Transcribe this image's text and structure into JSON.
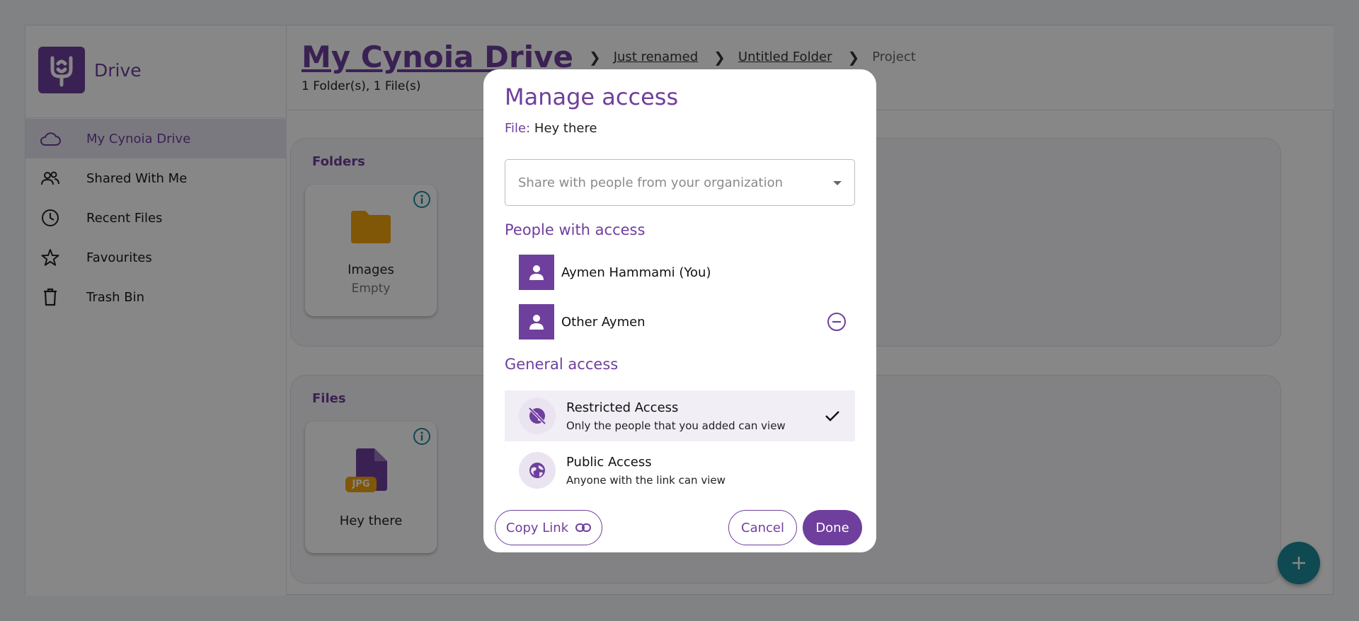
{
  "app": {
    "name": "Drive"
  },
  "sidebar": {
    "items": [
      {
        "label": "My Cynoia Drive",
        "icon": "cloud-icon",
        "active": true
      },
      {
        "label": "Shared With Me",
        "icon": "people-icon"
      },
      {
        "label": "Recent Files",
        "icon": "clock-icon"
      },
      {
        "label": "Favourites",
        "icon": "star-icon"
      },
      {
        "label": "Trash Bin",
        "icon": "trash-icon"
      }
    ]
  },
  "header": {
    "root": "My Cynoia Drive",
    "breadcrumbs": [
      "Just renamed",
      "Untitled Folder",
      "Project"
    ],
    "counts": "1 Folder(s), 1 File(s)"
  },
  "folders": {
    "title": "Folders",
    "items": [
      {
        "name": "Images",
        "status": "Empty"
      }
    ]
  },
  "files": {
    "title": "Files",
    "items": [
      {
        "name": "Hey there",
        "badge": "JPG"
      }
    ]
  },
  "dialog": {
    "title": "Manage access",
    "file_label": "File:",
    "file_name": "Hey there",
    "share_placeholder": "Share with people from your organization",
    "people_title": "People with access",
    "people": [
      {
        "name": "Aymen Hammami (You)",
        "removable": false
      },
      {
        "name": "Other Aymen",
        "removable": true
      }
    ],
    "general_title": "General access",
    "options": [
      {
        "title": "Restricted Access",
        "desc": "Only the people that you added can view",
        "selected": true
      },
      {
        "title": "Public Access",
        "desc": "Anyone with the link can view",
        "selected": false
      }
    ],
    "copy_link": "Copy Link",
    "cancel": "Cancel",
    "done": "Done"
  },
  "colors": {
    "accent": "#6f3f9d",
    "teal": "#1d8a9a",
    "folder": "#f2a30f"
  }
}
